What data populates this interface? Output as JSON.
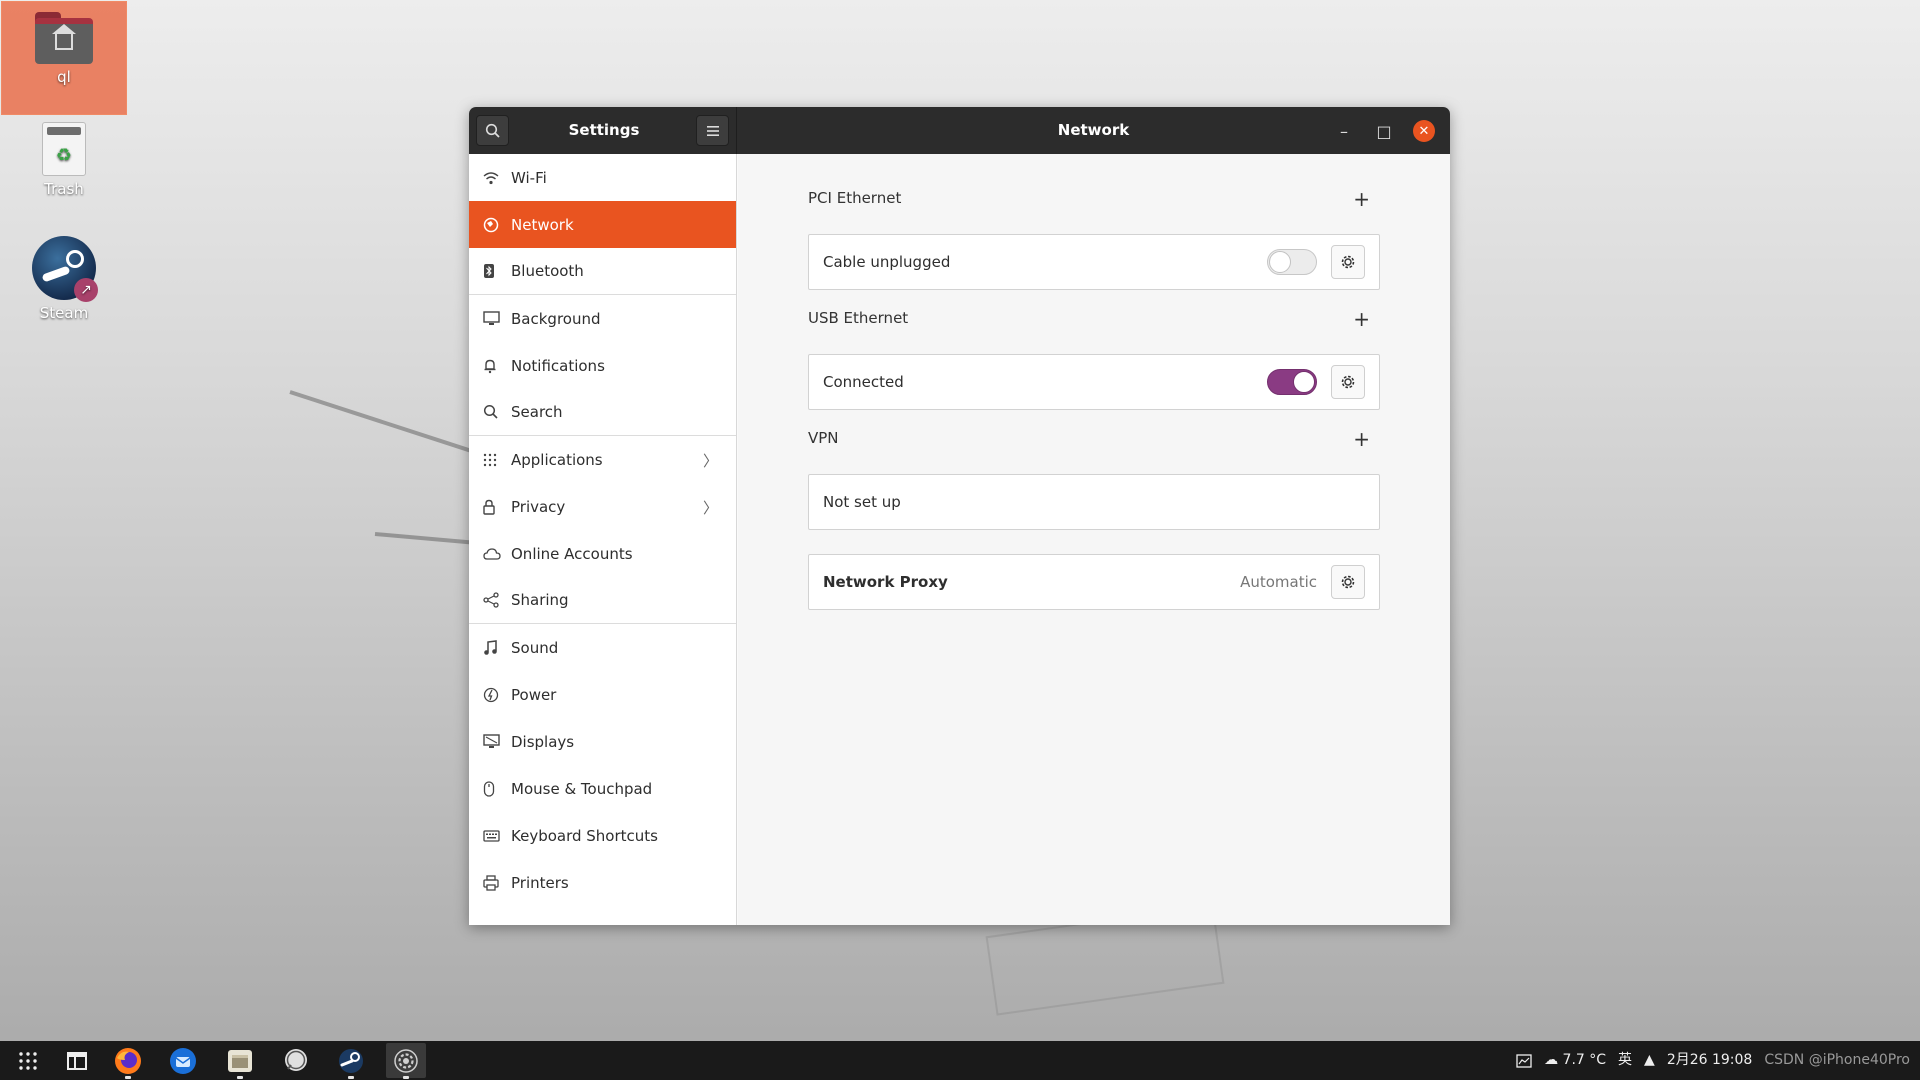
{
  "desktop": {
    "icons": [
      {
        "label": "ql"
      },
      {
        "label": "Trash"
      },
      {
        "label": "Steam"
      }
    ]
  },
  "window": {
    "sidebar_title": "Settings",
    "page_title": "Network",
    "close_glyph": "✕",
    "minimize_glyph": "–",
    "maximize_glyph": "□"
  },
  "sidebar": {
    "items": [
      {
        "label": "Wi-Fi",
        "icon": "wifi-icon"
      },
      {
        "label": "Network",
        "icon": "network-icon",
        "active": true
      },
      {
        "label": "Bluetooth",
        "icon": "bluetooth-icon"
      },
      {
        "label": "Background",
        "icon": "background-icon"
      },
      {
        "label": "Notifications",
        "icon": "bell-icon"
      },
      {
        "label": "Search",
        "icon": "search-icon"
      },
      {
        "label": "Applications",
        "icon": "apps-grid-icon",
        "has_chevron": true
      },
      {
        "label": "Privacy",
        "icon": "lock-icon",
        "has_chevron": true
      },
      {
        "label": "Online Accounts",
        "icon": "cloud-icon"
      },
      {
        "label": "Sharing",
        "icon": "share-icon"
      },
      {
        "label": "Sound",
        "icon": "music-note-icon"
      },
      {
        "label": "Power",
        "icon": "power-icon"
      },
      {
        "label": "Displays",
        "icon": "display-icon"
      },
      {
        "label": "Mouse & Touchpad",
        "icon": "mouse-icon"
      },
      {
        "label": "Keyboard Shortcuts",
        "icon": "keyboard-icon"
      },
      {
        "label": "Printers",
        "icon": "printer-icon"
      }
    ],
    "chevron": "〉"
  },
  "network": {
    "pci": {
      "title": "PCI Ethernet",
      "status": "Cable unplugged",
      "enabled": false
    },
    "usb": {
      "title": "USB Ethernet",
      "status": "Connected",
      "enabled": true
    },
    "vpn": {
      "title": "VPN",
      "status": "Not set up"
    },
    "proxy": {
      "label": "Network Proxy",
      "value": "Automatic"
    },
    "add_glyph": "+"
  },
  "taskbar": {
    "apps": [
      "app-grid",
      "show-desktop",
      "firefox",
      "thunderbird",
      "files",
      "chat",
      "steam",
      "settings"
    ],
    "tray": {
      "weather": "7.7 °C",
      "ime": "英",
      "datetime": "2月26 19:08",
      "overlay": "CSDN @iPhone40Pro"
    }
  },
  "colors": {
    "accent": "#e95420",
    "toggle_on": "#8a3b83",
    "titlebar": "#2c2c2c"
  }
}
